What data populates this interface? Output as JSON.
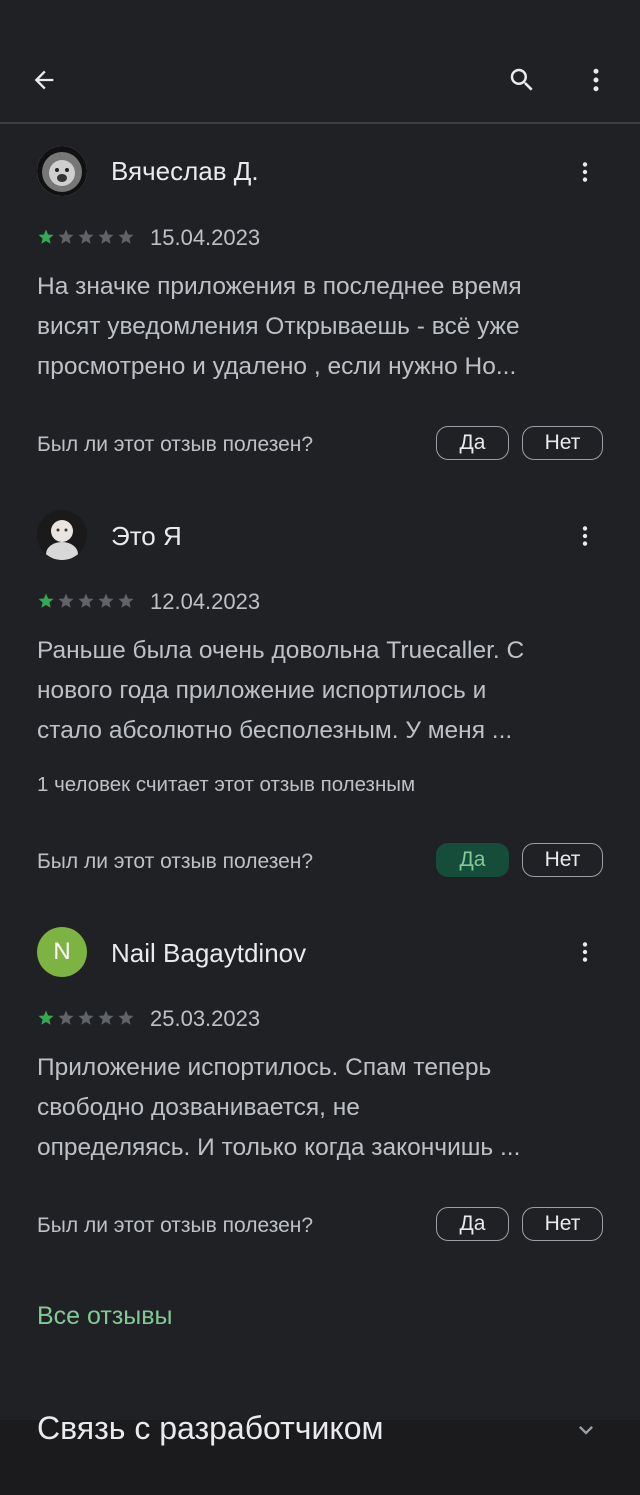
{
  "colors": {
    "background": "#202124",
    "accent": "#81c995",
    "star_filled": "#34a853",
    "star_empty": "#5f6368",
    "helpful_active_bg": "#164c3a"
  },
  "toolbar": {
    "back_icon": "arrow-left-icon",
    "search_icon": "search-icon",
    "menu_icon": "more-vert-icon"
  },
  "reviews": [
    {
      "author": "Вячеслав Д.",
      "avatar": "lion-photo",
      "rating": 1,
      "date": "15.04.2023",
      "lines": [
        "На значке приложения в последнее время",
        "висят уведомления Открываешь - всё уже",
        "просмотрено и удалено , если нужно Но..."
      ],
      "helpful_count": "",
      "helpful_question": "Был ли этот отзыв полезен?",
      "yes": "Да",
      "no": "Нет",
      "yes_selected": false
    },
    {
      "author": "Это Я",
      "avatar": "child-photo",
      "rating": 1,
      "date": "12.04.2023",
      "lines": [
        "Раньше была очень довольна Truecaller. С",
        "нового года приложение испортилось и",
        "стало абсолютно бесполезным. У меня ..."
      ],
      "helpful_count": "1 человек считает этот отзыв полезным",
      "helpful_question": "Был ли этот отзыв полезен?",
      "yes": "Да",
      "no": "Нет",
      "yes_selected": true
    },
    {
      "author": "Nail Bagaytdinov",
      "avatar_letter": "N",
      "avatar_color": "#7cb342",
      "rating": 1,
      "date": "25.03.2023",
      "lines": [
        "Приложение испортилось. Спам теперь",
        "свободно дозванивается, не",
        "определяясь. И только когда закончишь ..."
      ],
      "helpful_count": "",
      "helpful_question": "Был ли этот отзыв полезен?",
      "yes": "Да",
      "no": "Нет",
      "yes_selected": false
    }
  ],
  "all_reviews_link": "Все отзывы",
  "developer_section": {
    "title": "Связь с разработчиком",
    "icon": "chevron-down-icon"
  }
}
